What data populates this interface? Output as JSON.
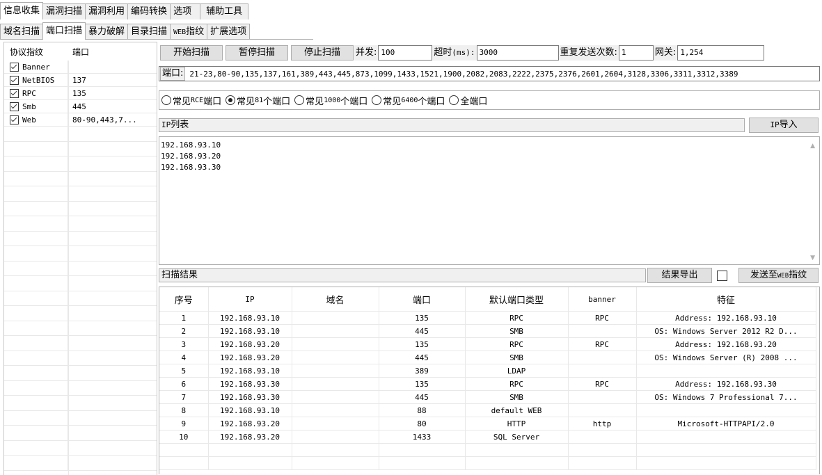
{
  "main_tabs": [
    "信息收集",
    "漏洞扫描",
    "漏洞利用",
    "编码转换",
    "选项",
    "辅助工具"
  ],
  "sub_tabs": [
    "域名扫描",
    "端口扫描",
    "暴力破解",
    "目录扫描",
    "WEB指纹",
    "扩展选项"
  ],
  "left": {
    "col_proto": "协议指纹",
    "col_port": "端口",
    "rows": [
      {
        "name": "Banner",
        "port": ""
      },
      {
        "name": "NetBIOS",
        "port": "137"
      },
      {
        "name": "RPC",
        "port": "135"
      },
      {
        "name": "Smb",
        "port": "445"
      },
      {
        "name": "Web",
        "port": "80-90,443,7..."
      }
    ]
  },
  "toolbar": {
    "start": "开始扫描",
    "pause": "暂停扫描",
    "stop": "停止扫描",
    "concurrency_label": "并发:",
    "concurrency_value": "100",
    "timeout_label_a": "超时",
    "timeout_label_b": "(ms):",
    "timeout_value": "3000",
    "retry_label": "重复发送次数:",
    "retry_value": "1",
    "gateway_label": "网关:",
    "gateway_value": "1,254"
  },
  "ports": {
    "label": "端口:",
    "value": "21-23,80-90,135,137,161,389,443,445,873,1099,1433,1521,1900,2082,2083,2222,2375,2376,2601,2604,3128,3306,3311,3312,3389"
  },
  "radios": [
    {
      "a": "常见",
      "b": "RCE",
      "c": "端口",
      "checked": false
    },
    {
      "a": "常见",
      "b": "81",
      "c": "个端口",
      "checked": true
    },
    {
      "a": "常见",
      "b": "1000",
      "c": "个端口",
      "checked": false
    },
    {
      "a": "常见",
      "b": "6400",
      "c": "个端口",
      "checked": false
    },
    {
      "a": "全端口",
      "b": "",
      "c": "",
      "checked": false
    }
  ],
  "ip_section": {
    "title_a": "IP",
    "title_b": "列表",
    "import_a": "IP",
    "import_b": "导入",
    "lines": [
      "192.168.93.10",
      "192.168.93.20",
      "192.168.93.30"
    ]
  },
  "result_section": {
    "title": "扫描结果",
    "export": "结果导出",
    "send_a": "发送至",
    "send_b": "WEB",
    "send_c": "指纹"
  },
  "table": {
    "headers": [
      "序号",
      "IP",
      "域名",
      "端口",
      "默认端口类型",
      "banner",
      "特征"
    ],
    "rows": [
      [
        "1",
        "192.168.93.10",
        "",
        "135",
        "RPC",
        "RPC",
        "Address: 192.168.93.10"
      ],
      [
        "2",
        "192.168.93.10",
        "",
        "445",
        "SMB",
        "",
        "OS: Windows Server 2012 R2 D..."
      ],
      [
        "3",
        "192.168.93.20",
        "",
        "135",
        "RPC",
        "RPC",
        "Address: 192.168.93.20"
      ],
      [
        "4",
        "192.168.93.20",
        "",
        "445",
        "SMB",
        "",
        "OS: Windows Server (R) 2008 ..."
      ],
      [
        "5",
        "192.168.93.10",
        "",
        "389",
        "LDAP",
        "",
        ""
      ],
      [
        "6",
        "192.168.93.30",
        "",
        "135",
        "RPC",
        "RPC",
        "Address: 192.168.93.30"
      ],
      [
        "7",
        "192.168.93.30",
        "",
        "445",
        "SMB",
        "",
        "OS: Windows 7 Professional 7..."
      ],
      [
        "8",
        "192.168.93.10",
        "",
        "88",
        "default WEB",
        "",
        ""
      ],
      [
        "9",
        "192.168.93.20",
        "",
        "80",
        "HTTP",
        "http",
        "Microsoft-HTTPAPI/2.0"
      ],
      [
        "10",
        "192.168.93.20",
        "",
        "1433",
        "SQL Server",
        "",
        ""
      ]
    ]
  }
}
